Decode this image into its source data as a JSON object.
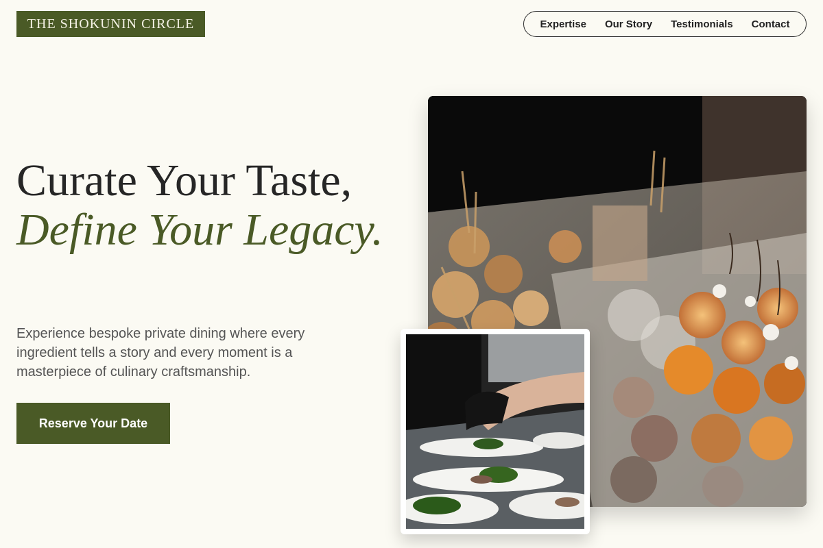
{
  "brand": {
    "name": "THE SHOKUNIN CIRCLE"
  },
  "nav": {
    "items": [
      {
        "label": "Expertise"
      },
      {
        "label": "Our Story"
      },
      {
        "label": "Testimonials"
      },
      {
        "label": "Contact"
      }
    ]
  },
  "hero": {
    "title_line1": "Curate Your Taste,",
    "title_accent": "Define Your Legacy.",
    "subtitle": "Experience bespoke private dining where every ingredient tells a story and every moment is a masterpiece of culinary craftsmanship.",
    "cta_label": "Reserve Your Date"
  },
  "images": {
    "main": {
      "icon": "canape-platter-photo"
    },
    "inset": {
      "icon": "chef-plating-photo"
    }
  },
  "colors": {
    "brand_green": "#4a5a26",
    "background": "#fbfaf3",
    "text_dark": "#262626"
  }
}
